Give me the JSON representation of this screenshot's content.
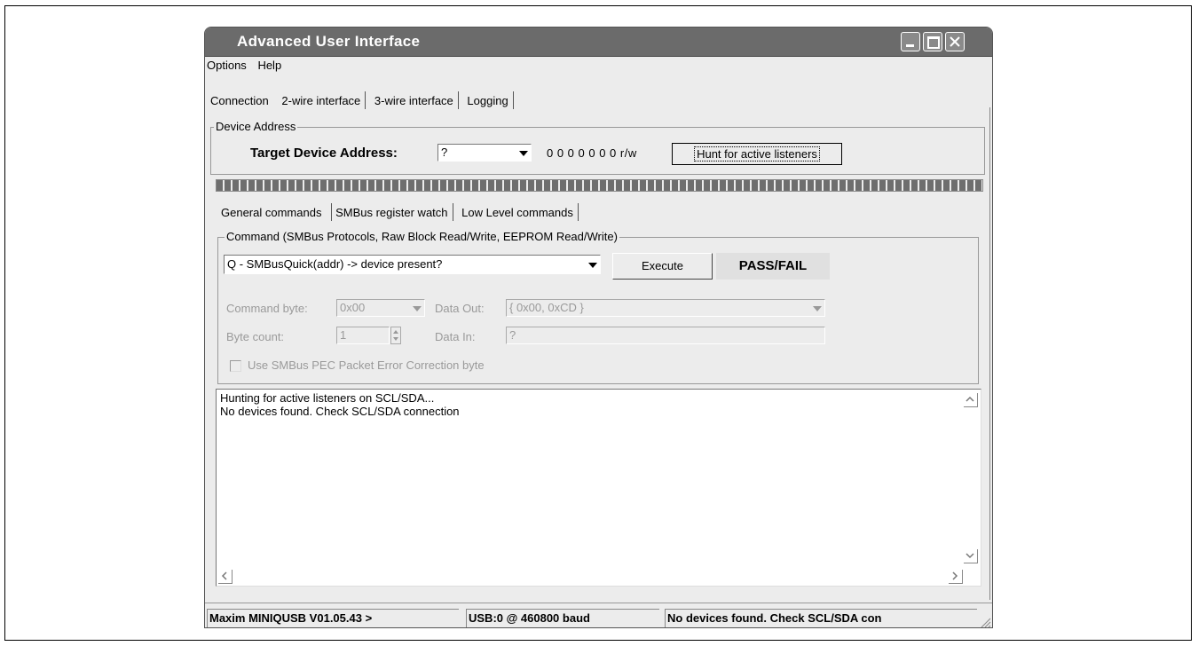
{
  "window": {
    "title": "Advanced User Interface"
  },
  "menu": [
    "Options",
    "Help"
  ],
  "top_tabs": [
    {
      "label": "Connection"
    },
    {
      "label": "2-wire interface"
    },
    {
      "label": "3-wire interface"
    },
    {
      "label": "Logging"
    }
  ],
  "device_address": {
    "group_label": "Device Address",
    "target_label": "Target Device Address:",
    "address_value": "?",
    "bits_text": "0 0 0 0 0 0 0 r/w",
    "hunt_button": "Hunt for active listeners"
  },
  "inner_tabs": [
    {
      "label": "General commands"
    },
    {
      "label": "SMBus register watch"
    },
    {
      "label": "Low Level commands"
    }
  ],
  "command": {
    "group_label": "Command (SMBus Protocols, Raw Block Read/Write, EEPROM Read/Write)",
    "selected_command": "Q - SMBusQuick(addr) -> device present?",
    "execute_button": "Execute",
    "result": "PASS/FAIL",
    "command_byte_label": "Command byte:",
    "command_byte_value": "0x00",
    "data_out_label": "Data Out:",
    "data_out_value": "{ 0x00, 0xCD }",
    "byte_count_label": "Byte count:",
    "byte_count_value": "1",
    "data_in_label": "Data In:",
    "data_in_value": "?",
    "pec_label": "Use SMBus PEC Packet Error Correction byte"
  },
  "log": [
    "Hunting for active listeners on SCL/SDA...",
    "No devices found. Check SCL/SDA connection"
  ],
  "status": {
    "device": "Maxim MINIQUSB V01.05.43 >",
    "usb": "USB:0 @ 460800 baud",
    "message": "No devices found. Check SCL/SDA con"
  }
}
